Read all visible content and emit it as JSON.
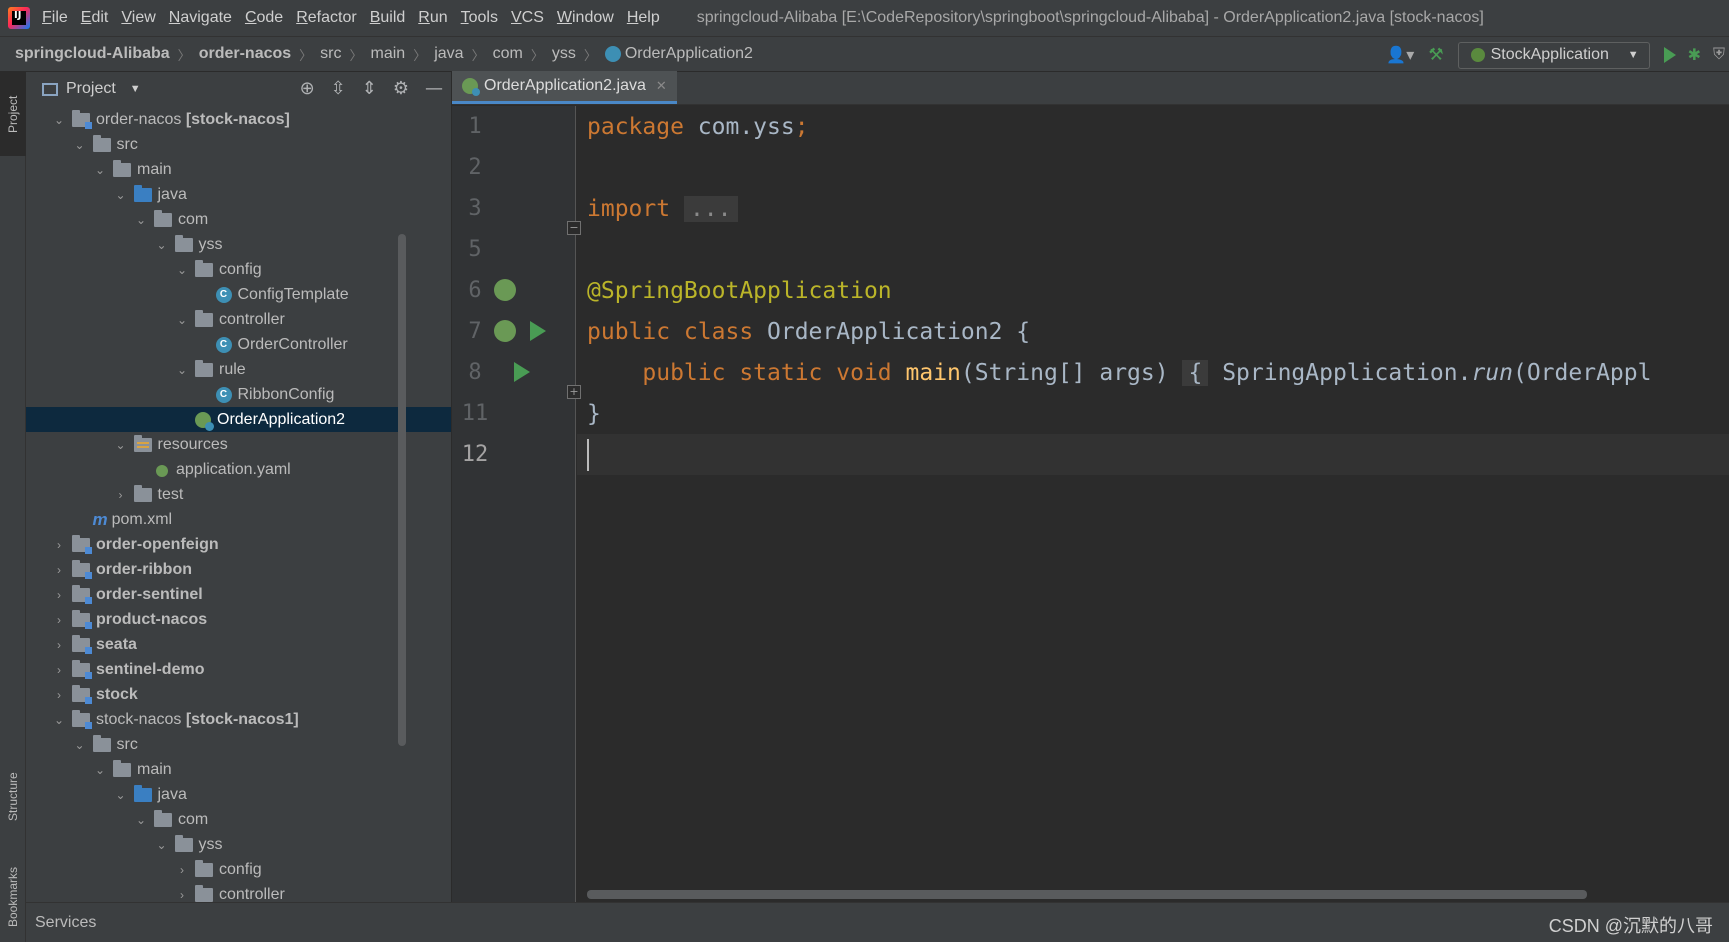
{
  "menu": {
    "items": [
      {
        "mn": "F",
        "rest": "ile"
      },
      {
        "mn": "E",
        "rest": "dit"
      },
      {
        "mn": "V",
        "rest": "iew"
      },
      {
        "mn": "N",
        "rest": "avigate"
      },
      {
        "mn": "C",
        "rest": "ode"
      },
      {
        "mn": "R",
        "rest": "efactor"
      },
      {
        "mn": "B",
        "rest": "uild"
      },
      {
        "mn": "R",
        "rest": "un"
      },
      {
        "mn": "T",
        "rest": "ools"
      },
      {
        "mn": "V",
        "rest": "CS"
      },
      {
        "mn": "W",
        "rest": "indow"
      },
      {
        "mn": "H",
        "rest": "elp"
      }
    ],
    "window_title": "springcloud-Alibaba [E:\\CodeRepository\\springboot\\springcloud-Alibaba] - OrderApplication2.java [stock-nacos]"
  },
  "breadcrumb": [
    "springcloud-Alibaba",
    "order-nacos",
    "src",
    "main",
    "java",
    "com",
    "yss",
    "OrderApplication2"
  ],
  "toolbar": {
    "run_config": "StockApplication"
  },
  "left_strip": {
    "project": "Project",
    "structure": "Structure",
    "bookmarks": "Bookmarks"
  },
  "project_panel": {
    "title": "Project",
    "tree": [
      {
        "level": 0,
        "chev": "open",
        "icon": "module",
        "name": "order-nacos",
        "suffix": " [stock-nacos]"
      },
      {
        "level": 1,
        "chev": "open",
        "icon": "folder",
        "name": "src"
      },
      {
        "level": 2,
        "chev": "open",
        "icon": "folder",
        "name": "main"
      },
      {
        "level": 3,
        "chev": "open",
        "icon": "folder-src",
        "name": "java"
      },
      {
        "level": 4,
        "chev": "open",
        "icon": "folder",
        "name": "com"
      },
      {
        "level": 5,
        "chev": "open",
        "icon": "folder",
        "name": "yss"
      },
      {
        "level": 6,
        "chev": "open",
        "icon": "folder",
        "name": "config"
      },
      {
        "level": 7,
        "chev": "none",
        "icon": "class",
        "name": "ConfigTemplate"
      },
      {
        "level": 6,
        "chev": "open",
        "icon": "folder",
        "name": "controller"
      },
      {
        "level": 7,
        "chev": "none",
        "icon": "class",
        "name": "OrderController"
      },
      {
        "level": 6,
        "chev": "open",
        "icon": "folder",
        "name": "rule"
      },
      {
        "level": 7,
        "chev": "none",
        "icon": "class",
        "name": "RibbonConfig"
      },
      {
        "level": 6,
        "chev": "none",
        "icon": "spring",
        "name": "OrderApplication2",
        "selected": true
      },
      {
        "level": 3,
        "chev": "open",
        "icon": "res",
        "name": "resources"
      },
      {
        "level": 4,
        "chev": "none",
        "icon": "yaml",
        "name": "application.yaml"
      },
      {
        "level": 3,
        "chev": "closed",
        "icon": "folder",
        "name": "test"
      },
      {
        "level": 1,
        "chev": "none",
        "icon": "maven",
        "name": "pom.xml"
      },
      {
        "level": 0,
        "chev": "closed",
        "icon": "module",
        "name": "order-openfeign",
        "bold": true
      },
      {
        "level": 0,
        "chev": "closed",
        "icon": "module",
        "name": "order-ribbon",
        "bold": true
      },
      {
        "level": 0,
        "chev": "closed",
        "icon": "module",
        "name": "order-sentinel",
        "bold": true
      },
      {
        "level": 0,
        "chev": "closed",
        "icon": "module",
        "name": "product-nacos",
        "bold": true
      },
      {
        "level": 0,
        "chev": "closed",
        "icon": "module",
        "name": "seata",
        "bold": true
      },
      {
        "level": 0,
        "chev": "closed",
        "icon": "module",
        "name": "sentinel-demo",
        "bold": true
      },
      {
        "level": 0,
        "chev": "closed",
        "icon": "module",
        "name": "stock",
        "bold": true
      },
      {
        "level": 0,
        "chev": "open",
        "icon": "module",
        "name": "stock-nacos",
        "suffix": " [stock-nacos1]"
      },
      {
        "level": 1,
        "chev": "open",
        "icon": "folder",
        "name": "src"
      },
      {
        "level": 2,
        "chev": "open",
        "icon": "folder",
        "name": "main"
      },
      {
        "level": 3,
        "chev": "open",
        "icon": "folder-src",
        "name": "java"
      },
      {
        "level": 4,
        "chev": "open",
        "icon": "folder",
        "name": "com"
      },
      {
        "level": 5,
        "chev": "open",
        "icon": "folder",
        "name": "yss"
      },
      {
        "level": 6,
        "chev": "closed",
        "icon": "folder",
        "name": "config"
      },
      {
        "level": 6,
        "chev": "closed",
        "icon": "folder",
        "name": "controller"
      }
    ]
  },
  "editor": {
    "tab_label": "OrderApplication2.java",
    "code": {
      "line1": {
        "num": "1",
        "kw": "package",
        "rest": " com.yss",
        "semi": ";"
      },
      "line2": {
        "num": "2"
      },
      "line3": {
        "num": "3",
        "kw": "import",
        "folded": "..."
      },
      "line5": {
        "num": "5"
      },
      "line6": {
        "num": "6",
        "ann": "@SpringBootApplication"
      },
      "line7": {
        "num": "7",
        "kw": "public class",
        "rest": " OrderApplication2 {"
      },
      "line8": {
        "num": "8",
        "kw": "public static void",
        "fn": "main",
        "params": "(String[] args)",
        "brace": "{",
        "cls": "SpringApplication.",
        "call": "run",
        "tail": "(OrderAppl"
      },
      "line11": {
        "num": "11",
        "text": "}"
      },
      "line12": {
        "num": "12"
      }
    }
  },
  "status": {
    "services": "Services",
    "watermark": "CSDN @沉默的八哥"
  }
}
